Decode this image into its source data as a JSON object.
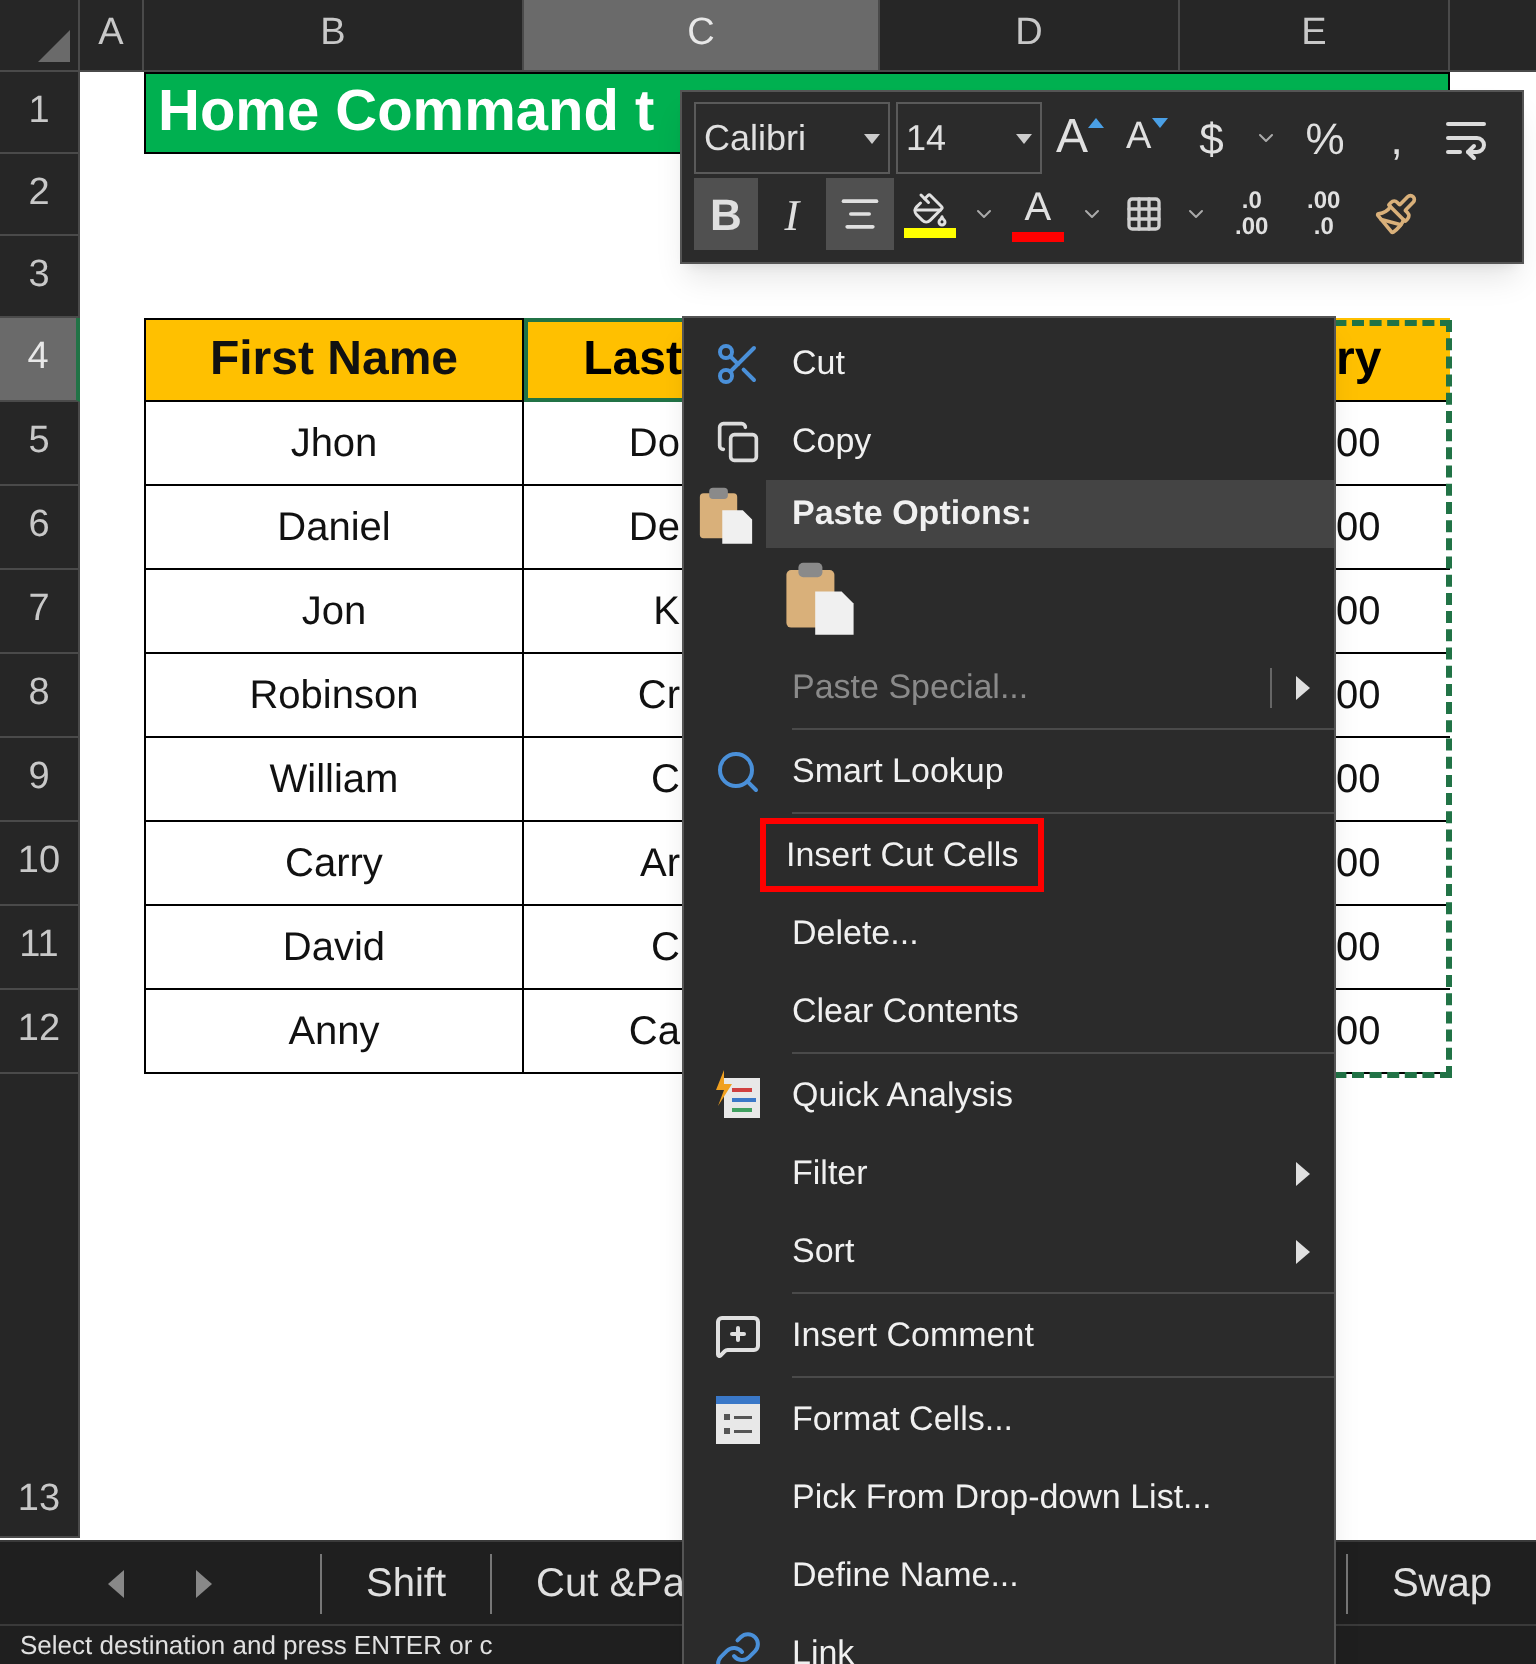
{
  "columns": [
    {
      "label": "A",
      "selected": false
    },
    {
      "label": "B",
      "selected": false
    },
    {
      "label": "C",
      "selected": true
    },
    {
      "label": "D",
      "selected": false
    },
    {
      "label": "E",
      "selected": false
    }
  ],
  "row_numbers": [
    {
      "label": "1",
      "selected": false
    },
    {
      "label": "2",
      "selected": false
    },
    {
      "label": "3",
      "selected": false
    },
    {
      "label": "4",
      "selected": true
    },
    {
      "label": "5",
      "selected": false
    },
    {
      "label": "6",
      "selected": false
    },
    {
      "label": "7",
      "selected": false
    },
    {
      "label": "8",
      "selected": false
    },
    {
      "label": "9",
      "selected": false
    },
    {
      "label": "10",
      "selected": false
    },
    {
      "label": "11",
      "selected": false
    },
    {
      "label": "12",
      "selected": false
    },
    {
      "label": "13",
      "selected": false
    }
  ],
  "title": "Home Command t",
  "table": {
    "columns": [
      "First Name",
      "Last",
      "ry"
    ],
    "rows": [
      [
        "Jhon",
        "Do",
        "00"
      ],
      [
        "Daniel",
        "De",
        "00"
      ],
      [
        "Jon",
        "K",
        "00"
      ],
      [
        "Robinson",
        "Cr",
        "00"
      ],
      [
        "William",
        "C",
        "00"
      ],
      [
        "Carry",
        "Ar",
        "00"
      ],
      [
        "David",
        "C",
        "00"
      ],
      [
        "Anny",
        "Ca",
        "00"
      ]
    ]
  },
  "mini_toolbar": {
    "font": "Calibri",
    "size": "14",
    "row_1": [
      {
        "kind": "grow",
        "label": "A"
      },
      {
        "kind": "shrink",
        "label": "A"
      },
      {
        "kind": "text",
        "label": "$"
      },
      {
        "kind": "dropdown"
      },
      {
        "kind": "text",
        "label": "%"
      },
      {
        "kind": "text",
        "label": ","
      },
      {
        "kind": "wrap"
      }
    ],
    "row_2": [
      {
        "kind": "text",
        "label": "B",
        "pressed": true
      },
      {
        "kind": "text",
        "label": "I",
        "pressed": false
      },
      {
        "kind": "align",
        "pressed": true
      },
      {
        "kind": "fill",
        "color": "#ffff00"
      },
      {
        "kind": "dropdown"
      },
      {
        "kind": "fontcolor",
        "label": "A",
        "color": "#ff0000"
      },
      {
        "kind": "dropdown"
      },
      {
        "kind": "borders"
      },
      {
        "kind": "dropdown"
      },
      {
        "kind": "decimal",
        "lines": [
          ".0",
          ".00"
        ]
      },
      {
        "kind": "decimal",
        "lines": [
          ".00",
          ".0"
        ]
      },
      {
        "kind": "painter"
      }
    ]
  },
  "context_menu": {
    "items": [
      {
        "kind": "cut",
        "label": "Cut",
        "disabled": false,
        "submenu": false,
        "highlighted": false
      },
      {
        "kind": "copy",
        "label": "Copy",
        "disabled": false,
        "submenu": false,
        "highlighted": false
      },
      {
        "kind": "heading",
        "label": "Paste Options:"
      },
      {
        "kind": "paste"
      },
      {
        "kind": "item",
        "label": "Paste Special...",
        "disabled": true,
        "submenu": true,
        "highlighted": false
      },
      {
        "kind": "separator"
      },
      {
        "kind": "lookup",
        "label": "Smart Lookup",
        "disabled": false,
        "submenu": false,
        "highlighted": false
      },
      {
        "kind": "separator"
      },
      {
        "kind": "item",
        "label": "Insert Cut Cells",
        "disabled": false,
        "submenu": false,
        "highlighted": true
      },
      {
        "kind": "item",
        "label": "Delete...",
        "disabled": false,
        "submenu": false,
        "highlighted": false
      },
      {
        "kind": "item",
        "label": "Clear Contents",
        "disabled": false,
        "submenu": false,
        "highlighted": false
      },
      {
        "kind": "separator"
      },
      {
        "kind": "analysis",
        "label": "Quick Analysis",
        "disabled": false,
        "submenu": false,
        "highlighted": false
      },
      {
        "kind": "item",
        "label": "Filter",
        "disabled": false,
        "submenu": true,
        "highlighted": false
      },
      {
        "kind": "item",
        "label": "Sort",
        "disabled": false,
        "submenu": true,
        "highlighted": false
      },
      {
        "kind": "separator"
      },
      {
        "kind": "comment",
        "label": "Insert Comment",
        "disabled": false,
        "submenu": false,
        "highlighted": false
      },
      {
        "kind": "separator"
      },
      {
        "kind": "format",
        "label": "Format Cells...",
        "disabled": false,
        "submenu": false,
        "highlighted": false
      },
      {
        "kind": "item",
        "label": "Pick From Drop-down List...",
        "disabled": false,
        "submenu": false,
        "highlighted": false
      },
      {
        "kind": "item",
        "label": "Define Name...",
        "disabled": false,
        "submenu": false,
        "highlighted": false
      },
      {
        "kind": "link",
        "label": "Link",
        "disabled": false,
        "submenu": false,
        "highlighted": false
      }
    ]
  },
  "sheet_tabs": [
    {
      "label": "Shift"
    },
    {
      "label": "Cut &Pa"
    },
    {
      "label": "Swap"
    }
  ],
  "status_bar": "Select destination and press ENTER or c"
}
